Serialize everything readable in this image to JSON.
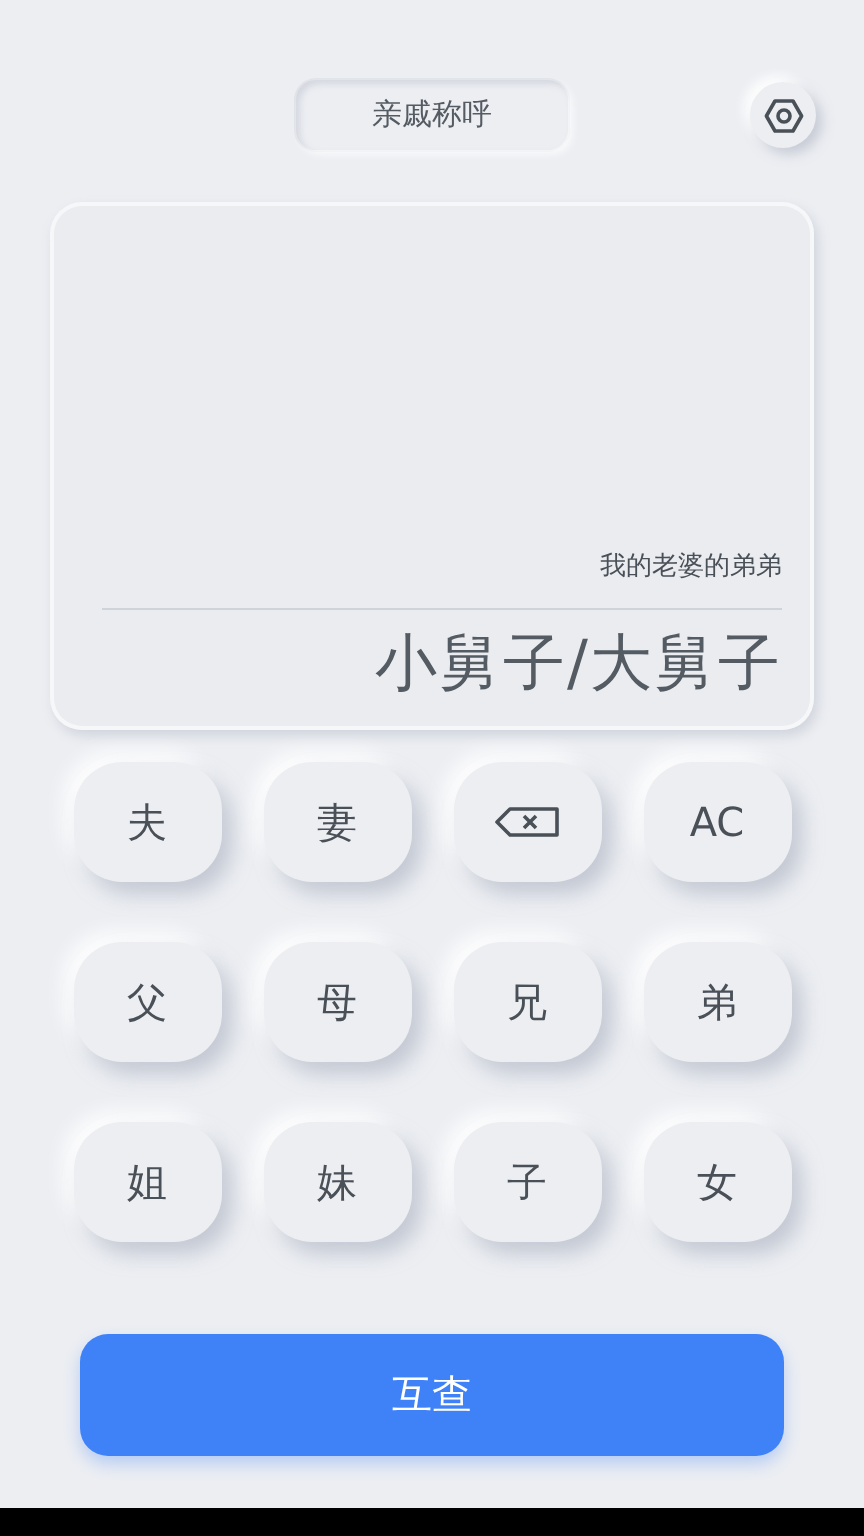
{
  "title": "亲戚称呼",
  "display": {
    "expression": "我的老婆的弟弟",
    "result": "小舅子/大舅子"
  },
  "keys": [
    {
      "kind": "char",
      "label": "夫"
    },
    {
      "kind": "char",
      "label": "妻"
    },
    {
      "kind": "backspace"
    },
    {
      "kind": "char",
      "label": "AC"
    },
    {
      "kind": "char",
      "label": "父"
    },
    {
      "kind": "char",
      "label": "母"
    },
    {
      "kind": "char",
      "label": "兄"
    },
    {
      "kind": "char",
      "label": "弟"
    },
    {
      "kind": "char",
      "label": "姐"
    },
    {
      "kind": "char",
      "label": "妹"
    },
    {
      "kind": "char",
      "label": "子"
    },
    {
      "kind": "char",
      "label": "女"
    }
  ],
  "action_button": "互查"
}
